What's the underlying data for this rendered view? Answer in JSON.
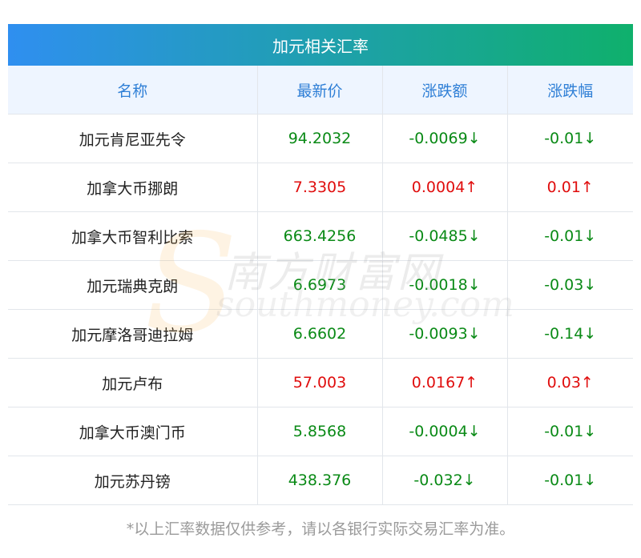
{
  "table_title": "加元相关汇率",
  "columns": [
    "名称",
    "最新价",
    "涨跌额",
    "涨跌幅"
  ],
  "rows": [
    {
      "name": "加元肯尼亚先令",
      "price": "94.2032",
      "change": "-0.0069↓",
      "pct": "-0.01↓",
      "direction": "down"
    },
    {
      "name": "加拿大币挪朗",
      "price": "7.3305",
      "change": "0.0004↑",
      "pct": "0.01↑",
      "direction": "up"
    },
    {
      "name": "加拿大币智利比索",
      "price": "663.4256",
      "change": "-0.0485↓",
      "pct": "-0.01↓",
      "direction": "down"
    },
    {
      "name": "加元瑞典克朗",
      "price": "6.6973",
      "change": "-0.0018↓",
      "pct": "-0.03↓",
      "direction": "down"
    },
    {
      "name": "加元摩洛哥迪拉姆",
      "price": "6.6602",
      "change": "-0.0093↓",
      "pct": "-0.14↓",
      "direction": "down"
    },
    {
      "name": "加元卢布",
      "price": "57.003",
      "change": "0.0167↑",
      "pct": "0.03↑",
      "direction": "up"
    },
    {
      "name": "加拿大币澳门币",
      "price": "5.8568",
      "change": "-0.0004↓",
      "pct": "-0.01↓",
      "direction": "down"
    },
    {
      "name": "加元苏丹镑",
      "price": "438.376",
      "change": "-0.032↓",
      "pct": "-0.01↓",
      "direction": "down"
    }
  ],
  "footnote": "*以上汇率数据仅供参考，请以各银行实际交易汇率为准。",
  "watermark": {
    "cn": "南方财富网",
    "en": "southmoney.com"
  },
  "colors": {
    "up": "#e00d0d",
    "down": "#0a8a16",
    "header_text": "#2f7fd6",
    "gradient_start": "#2f8ff0",
    "gradient_end": "#0fb06c"
  }
}
